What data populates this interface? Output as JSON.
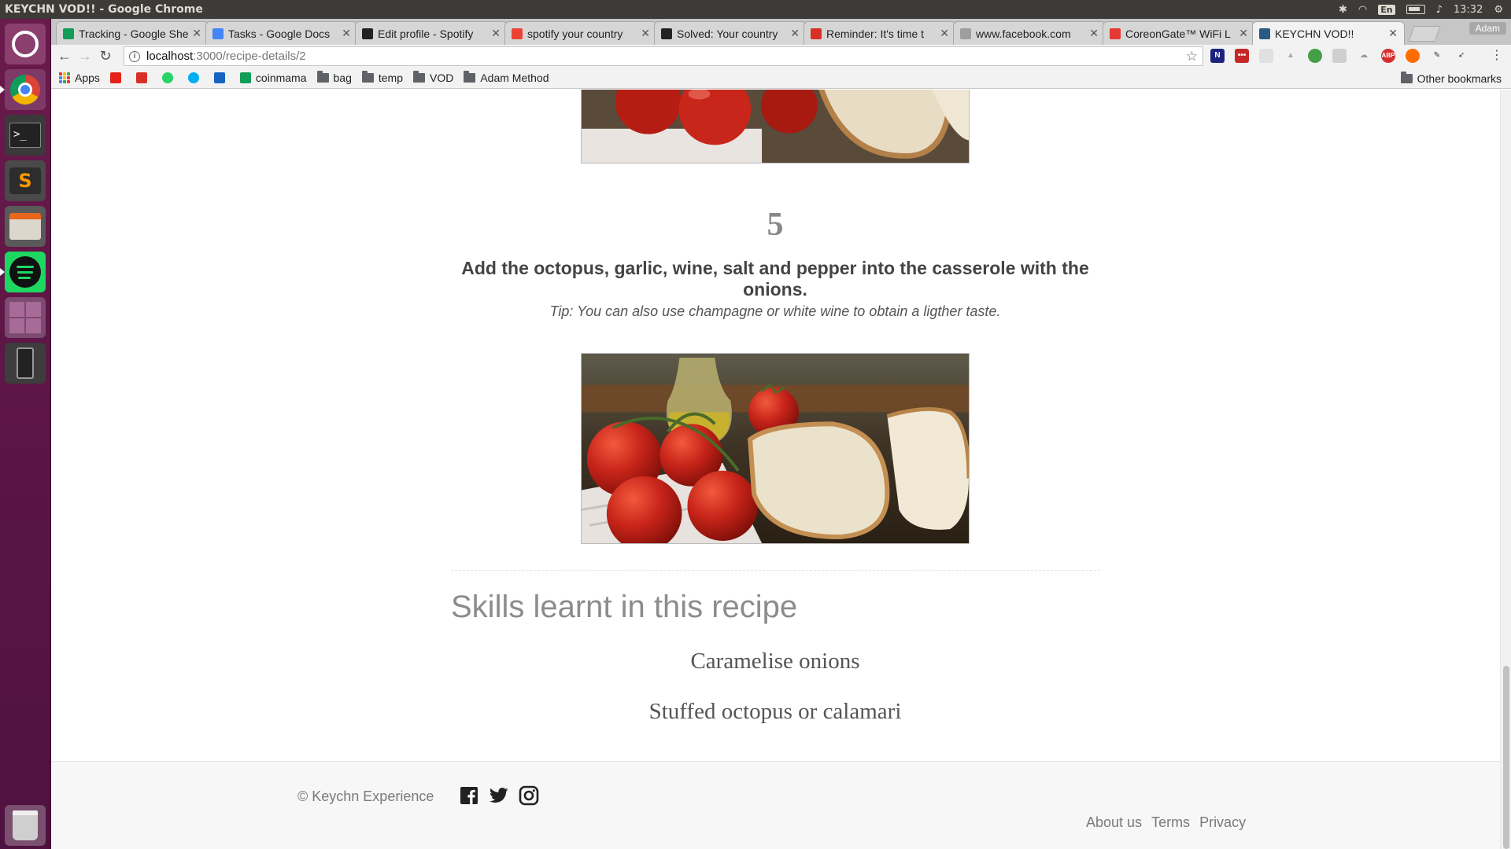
{
  "window": {
    "title": "KEYCHN VOD!! - Google Chrome",
    "clock": "13:32",
    "keyboard_layout": "En",
    "profile_name": "Adam"
  },
  "launcher": [
    {
      "name": "dash",
      "color": "#8a3f6f"
    },
    {
      "name": "chrome",
      "color": "#7d3a68"
    },
    {
      "name": "terminal",
      "color": "#3a3a3a"
    },
    {
      "name": "sublime-text",
      "color": "#4a4a4a"
    },
    {
      "name": "files",
      "color": "#5a5a5a"
    },
    {
      "name": "spotify",
      "color": "#1ed760"
    },
    {
      "name": "workspace-switcher",
      "color": "#7b4b72"
    },
    {
      "name": "phone",
      "color": "#3d3d3d"
    },
    {
      "name": "trash",
      "color": "#7a4f6f"
    }
  ],
  "tabs": [
    {
      "label": "Tracking - Google She",
      "favicon_color": "#0f9d58"
    },
    {
      "label": "Tasks - Google Docs",
      "favicon_color": "#4285f4"
    },
    {
      "label": "Edit profile - Spotify",
      "favicon_color": "#222222"
    },
    {
      "label": "spotify your country",
      "favicon_color": "#ea4335"
    },
    {
      "label": "Solved: Your country",
      "favicon_color": "#222222"
    },
    {
      "label": "Reminder: It's time t",
      "favicon_color": "#d93025"
    },
    {
      "label": "www.facebook.com",
      "favicon_color": "#9e9e9e"
    },
    {
      "label": "CoreonGate™ WiFi L",
      "favicon_color": "#e53935"
    },
    {
      "label": "KEYCHN VOD!!",
      "favicon_color": "#2b5b84",
      "active": true
    }
  ],
  "address_bar": {
    "host": "localhost",
    "path": ":3000/recipe-details/2"
  },
  "bookmarks": [
    {
      "label": "Apps",
      "type": "apps"
    },
    {
      "label": "",
      "type": "youtube",
      "color": "#e62117"
    },
    {
      "label": "",
      "type": "gmail",
      "color": "#d93025"
    },
    {
      "label": "",
      "type": "whatsapp",
      "color": "#25d366"
    },
    {
      "label": "",
      "type": "skype",
      "color": "#00aff0"
    },
    {
      "label": "",
      "type": "arrow",
      "color": "#1565c0"
    },
    {
      "label": "coinmama",
      "type": "site",
      "color": "#0f9d58"
    },
    {
      "label": "bag",
      "type": "folder"
    },
    {
      "label": "temp",
      "type": "folder"
    },
    {
      "label": "VOD",
      "type": "folder"
    },
    {
      "label": "Adam Method",
      "type": "folder"
    }
  ],
  "other_bookmarks": "Other bookmarks",
  "step": {
    "number": "5",
    "text": "Add the octopus, garlic, wine, salt and pepper into the casserole with the onions.",
    "tip": "Tip: You can also use champagne or white wine to obtain a ligther taste."
  },
  "skills": {
    "heading": "Skills learnt in this recipe",
    "items": [
      "Caramelise onions",
      "Stuffed octopus or calamari"
    ]
  },
  "footer": {
    "copyright": "© Keychn Experience",
    "social": [
      "facebook-icon",
      "twitter-icon",
      "instagram-icon"
    ],
    "links": [
      "About us",
      "Terms",
      "Privacy"
    ]
  }
}
